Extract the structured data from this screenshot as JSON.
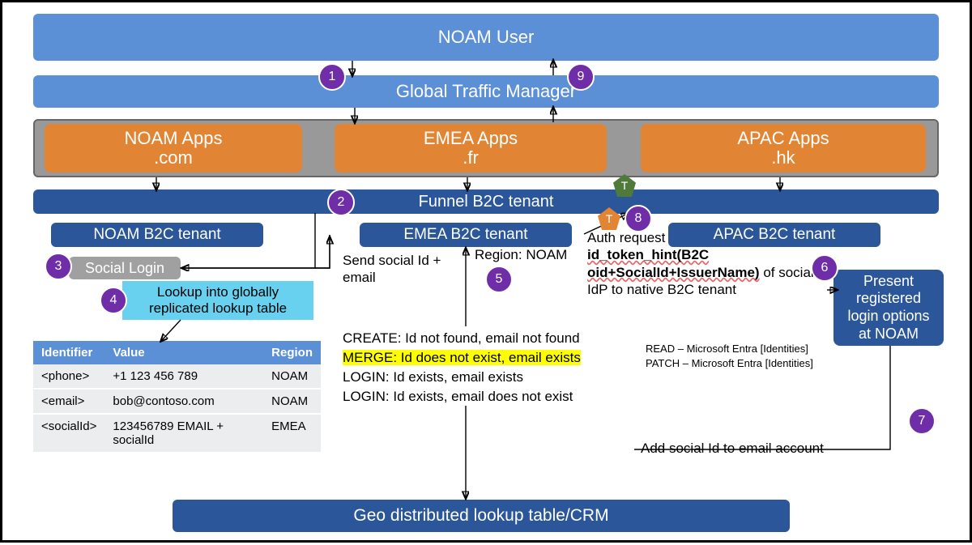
{
  "bars": {
    "noam_user": "NOAM User",
    "gtm": "Global Traffic Manager",
    "funnel": "Funnel B2C tenant",
    "geo": "Geo distributed lookup table/CRM"
  },
  "apps": {
    "noam": {
      "l1": "NOAM Apps",
      "l2": ".com"
    },
    "emea": {
      "l1": "EMEA Apps",
      "l2": ".fr"
    },
    "apac": {
      "l1": "APAC Apps",
      "l2": ".hk"
    }
  },
  "tenants": {
    "noam": "NOAM B2C tenant",
    "emea": "EMEA B2C tenant",
    "apac": "APAC B2C tenant"
  },
  "social_login": "Social Login",
  "lookup_note": "Lookup into globally replicated lookup table",
  "present_box": "Present registered login options at NOAM",
  "steps": {
    "1": "1",
    "2": "2",
    "3": "3",
    "4": "4",
    "5": "5",
    "6": "6",
    "7": "7",
    "8": "8",
    "9": "9"
  },
  "pentagon": {
    "green": "T",
    "orange": "T"
  },
  "annotations": {
    "send_social": "Send social Id + email",
    "region_noam": "Region: NOAM",
    "auth_request_line1": "Auth request",
    "auth_request_bold": "id_token_hint(B2C oid+SocialId+IssuerName)",
    "auth_request_line3": " of social IdP to native B2C tenant",
    "add_social": "Add social Id to email account",
    "read": "READ – Microsoft Entra [Identities]",
    "patch": "PATCH – Microsoft Entra [Identities]"
  },
  "logic": {
    "create": "CREATE: Id not found, email not found",
    "merge": "MERGE: Id does not exist, email exists",
    "login1": "LOGIN: Id exists, email exists",
    "login2": "LOGIN: Id exists, email does not exist"
  },
  "table": {
    "headers": {
      "id": "Identifier",
      "val": "Value",
      "region": "Region"
    },
    "rows": [
      {
        "id": "<phone>",
        "val": "+1 123 456 789",
        "region": "NOAM"
      },
      {
        "id": "<email>",
        "val": "bob@contoso.com",
        "region": "NOAM"
      },
      {
        "id": "<socialId>",
        "val": "123456789 EMAIL + socialId",
        "region": "EMEA"
      }
    ]
  }
}
